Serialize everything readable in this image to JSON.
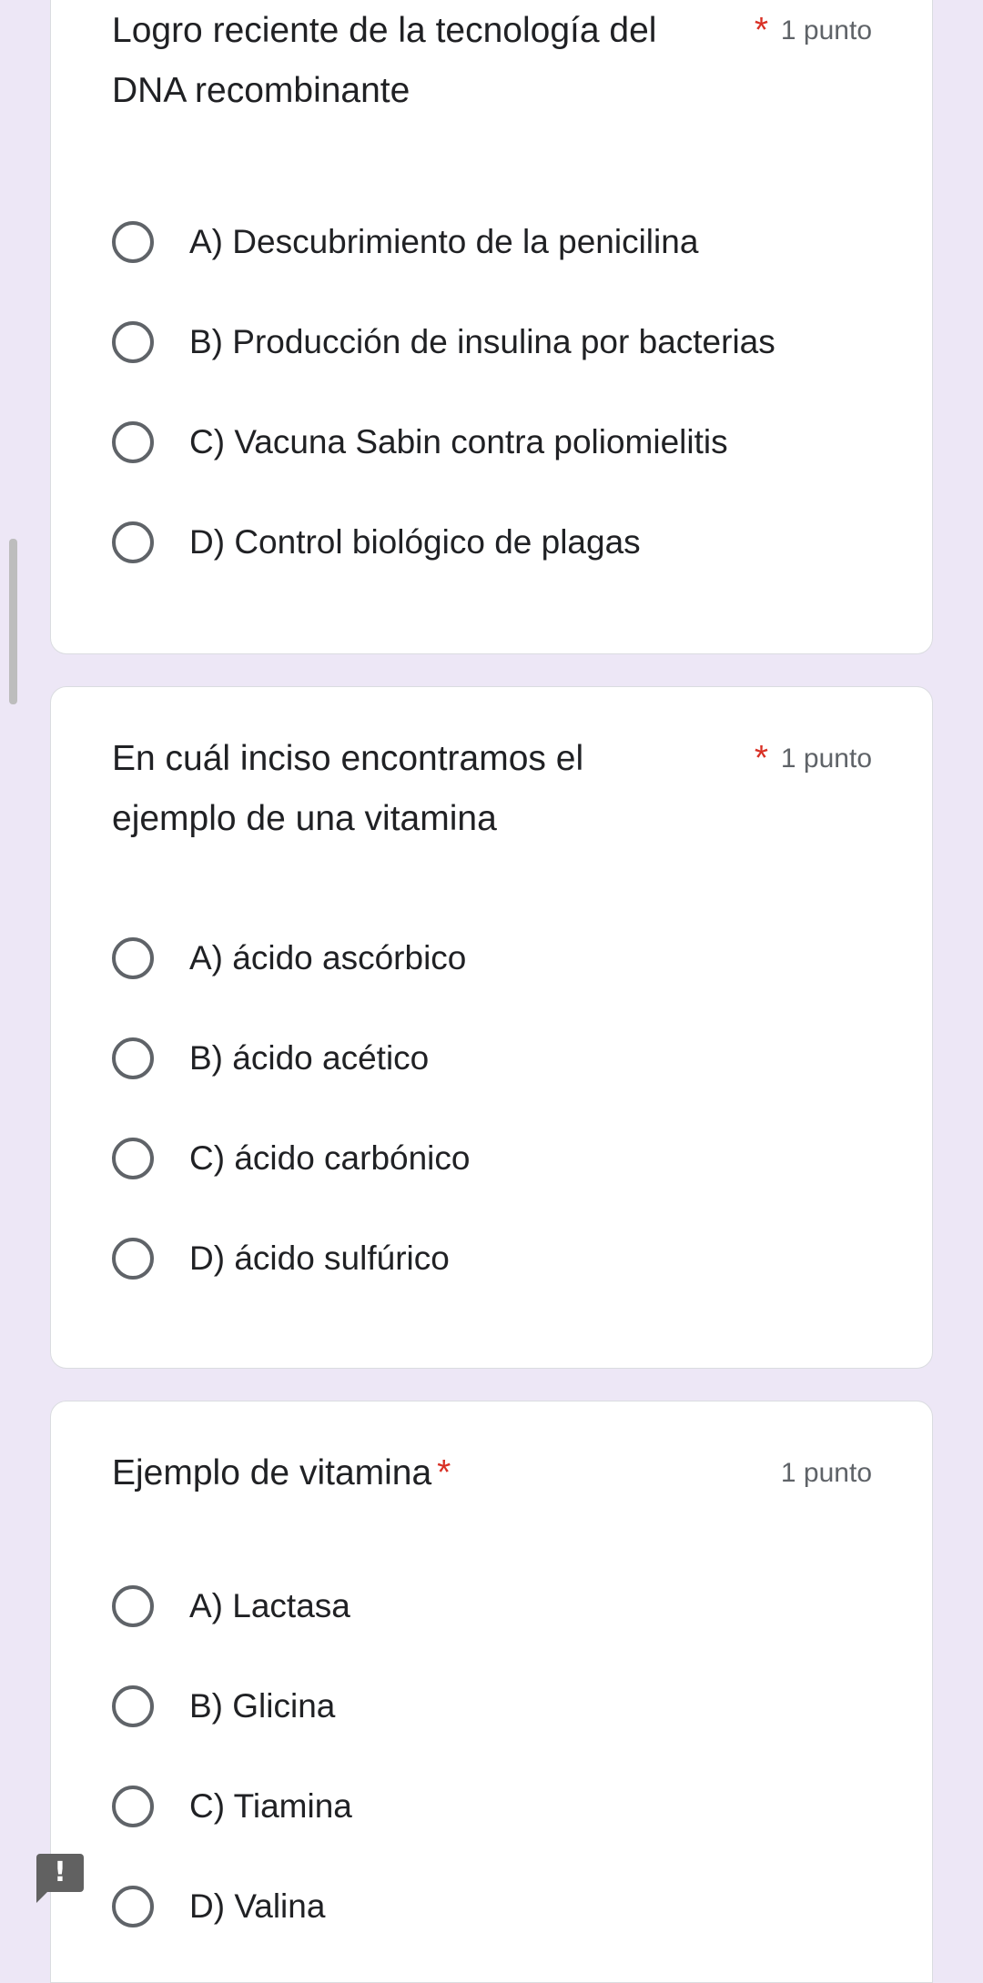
{
  "questions": [
    {
      "title_line1": "Logro reciente de la tecnología del",
      "title_line2": "DNA recombinante",
      "required_mark": "*",
      "points": "1 punto",
      "options": [
        "A) Descubrimiento de la penicilina",
        "B) Producción de insulina por bacterias",
        "C) Vacuna Sabin contra poliomielitis",
        "D) Control biológico de plagas"
      ]
    },
    {
      "title_line1": "En cuál inciso encontramos el",
      "title_line2": "ejemplo de una vitamina",
      "required_mark": "*",
      "points": "1 punto",
      "options": [
        "A) ácido ascórbico",
        "B) ácido acético",
        "C) ácido carbónico",
        "D) ácido sulfúrico"
      ]
    },
    {
      "title_line1": "Ejemplo de vitamina",
      "required_mark": "*",
      "points": "1 punto",
      "options": [
        "A) Lactasa",
        "B) Glicina",
        "C) Tiamina",
        "D) Valina"
      ]
    }
  ],
  "error_badge": {
    "icon": "exclamation-icon",
    "text": "!"
  },
  "colors": {
    "background": "#ede7f6",
    "required": "#d93025",
    "secondary_text": "#5f6368"
  }
}
